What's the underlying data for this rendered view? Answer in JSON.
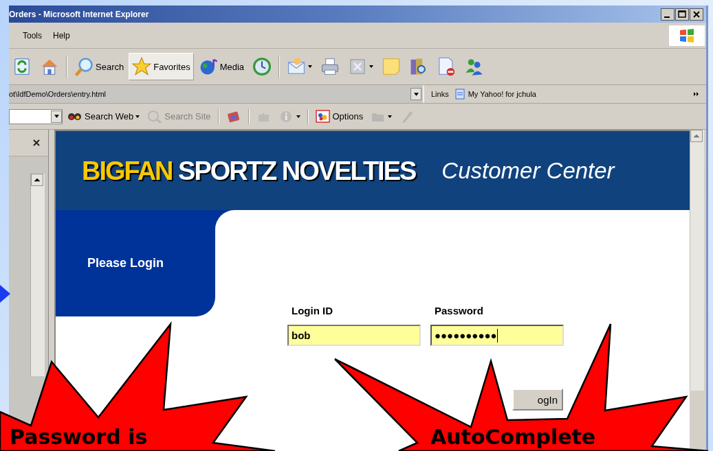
{
  "window": {
    "title": "Orders - Microsoft Internet Explorer"
  },
  "menu": [
    {
      "label": "Tools"
    },
    {
      "label": "Help"
    }
  ],
  "toolbar": [
    {
      "kind": "button",
      "pressed": false,
      "dropdown": false
    },
    {
      "kind": "button",
      "pressed": false,
      "dropdown": false
    },
    {
      "kind": "separator"
    },
    {
      "kind": "button",
      "label": "Search",
      "pressed": false,
      "dropdown": false
    },
    {
      "kind": "button",
      "label": "Favorites",
      "pressed": true,
      "dropdown": false
    },
    {
      "kind": "button",
      "label": "Media",
      "pressed": false,
      "dropdown": false
    },
    {
      "kind": "button",
      "pressed": false,
      "dropdown": false
    },
    {
      "kind": "separator"
    },
    {
      "kind": "button",
      "pressed": false,
      "dropdown": true
    },
    {
      "kind": "button",
      "pressed": false,
      "dropdown": false
    },
    {
      "kind": "button",
      "pressed": false,
      "dropdown": true
    },
    {
      "kind": "button",
      "pressed": false,
      "dropdown": false
    },
    {
      "kind": "button",
      "pressed": false,
      "dropdown": false
    },
    {
      "kind": "button",
      "pressed": false,
      "dropdown": false
    },
    {
      "kind": "button",
      "pressed": false,
      "dropdown": false
    }
  ],
  "address": {
    "value": "ot\\IdfDemo\\Orders\\entry.html"
  },
  "links": {
    "label": "Links",
    "items": [
      "My Yahoo! for jchula"
    ]
  },
  "search_toolbar": [
    {
      "kind": "button",
      "label": "Search Web",
      "disabled": false,
      "dropdown": true
    },
    {
      "kind": "button",
      "label": "Search Site",
      "disabled": true,
      "dropdown": false
    },
    {
      "kind": "separator"
    },
    {
      "kind": "button",
      "disabled": false,
      "dropdown": false
    },
    {
      "kind": "separator"
    },
    {
      "kind": "button",
      "disabled": true,
      "dropdown": false
    },
    {
      "kind": "button",
      "disabled": true,
      "dropdown": true
    },
    {
      "kind": "separator"
    },
    {
      "kind": "button",
      "label": "Options",
      "disabled": false,
      "dropdown": false
    },
    {
      "kind": "button",
      "disabled": true,
      "dropdown": true
    },
    {
      "kind": "button",
      "disabled": true,
      "dropdown": false
    }
  ],
  "page": {
    "brand_first": "BIGFAN",
    "brand_rest": "SPORTZ NOVELTIES",
    "subtitle": "Customer Center",
    "section": "Please Login",
    "fields": [
      {
        "label": "Login ID",
        "value": "bob",
        "focused": false
      },
      {
        "label": "Password",
        "value": "●●●●●●●●●●",
        "focused": true
      }
    ],
    "button": "ogIn"
  },
  "callouts": [
    {
      "text": "Password is"
    },
    {
      "text": "AutoComplete"
    }
  ]
}
